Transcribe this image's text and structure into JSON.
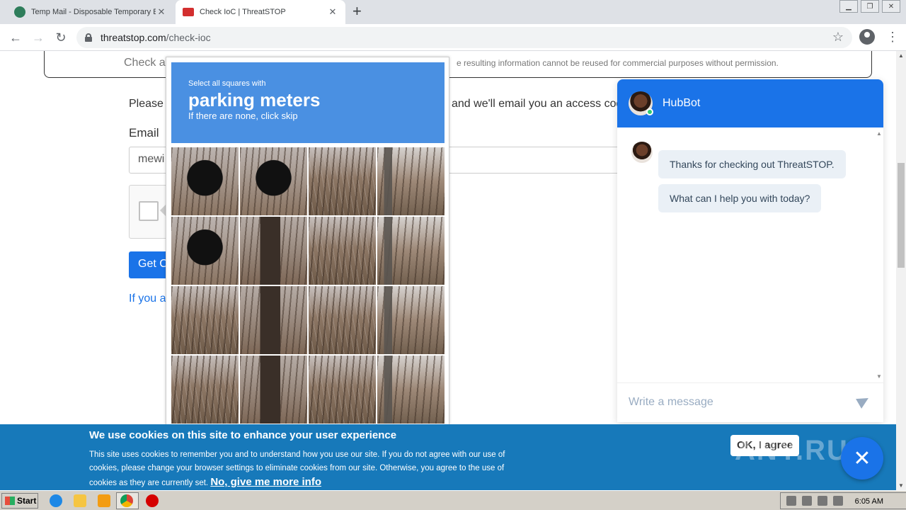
{
  "browser": {
    "tabs": [
      {
        "title": "Temp Mail - Disposable Temporary E",
        "active": false
      },
      {
        "title": "Check IoC | ThreatSTOP",
        "active": true
      }
    ],
    "url_host": "threatstop.com",
    "url_path": "/check-ioc"
  },
  "page": {
    "notice_left": "Check a",
    "notice_right": "e resulting information cannot be reused for commercial purposes without permission.",
    "please_left": "Please",
    "please_right": "and we'll email you an access cod",
    "email_label": "Email",
    "email_value": "mewi",
    "get_button": "Get C",
    "if_link": "If you al"
  },
  "captcha": {
    "instruction_small": "Select all squares with",
    "instruction_target": "parking meters",
    "instruction_hint": "If there are none, click skip"
  },
  "chat": {
    "bot_name": "HubBot",
    "messages": [
      "Thanks for checking out ThreatSTOP.",
      "What can I help you with today?"
    ],
    "input_placeholder": "Write a message"
  },
  "cookie": {
    "title": "We use cookies on this site to enhance your user experience",
    "text": "This site uses cookies to remember you and to understand how you use our site. If you do not agree with our use of cookies, please change your browser settings to eliminate cookies from our site. Otherwise, you agree to the use of cookies as they are currently set.",
    "link": "No, give me more info",
    "ok_button": "OK, I agree"
  },
  "taskbar": {
    "start_label": "Start",
    "clock": "6:05 AM"
  },
  "watermark": "ANY.RUN",
  "colors": {
    "accent": "#1a73e8",
    "captcha_header": "#4a90e2",
    "cookie_bg": "#1779ba"
  }
}
